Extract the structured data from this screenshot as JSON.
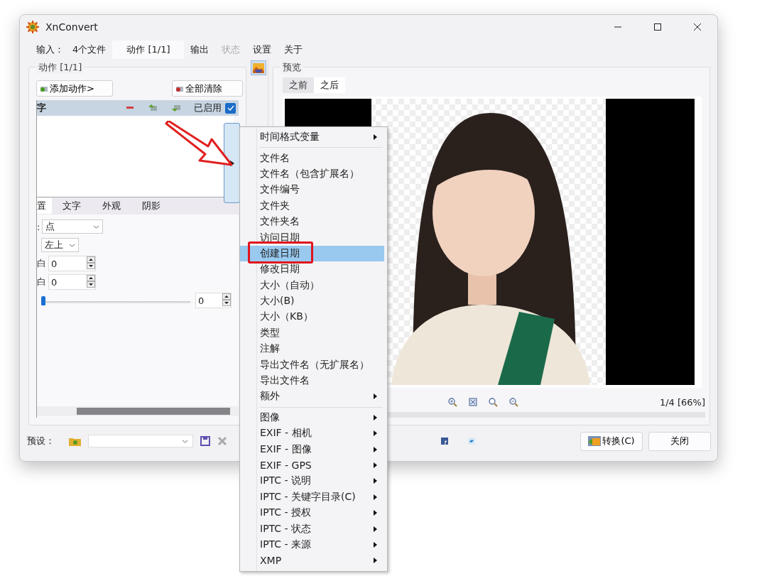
{
  "window": {
    "title": "XnConvert"
  },
  "tabs": [
    {
      "label": "输入：",
      "count": "4个文件",
      "selected": false,
      "disabled": false
    },
    {
      "label": "动作 [1/1]",
      "selected": true,
      "disabled": false
    },
    {
      "label": "输出",
      "selected": false,
      "disabled": false
    },
    {
      "label": "状态",
      "selected": false,
      "disabled": true
    },
    {
      "label": "设置",
      "selected": false,
      "disabled": false
    },
    {
      "label": "关于",
      "selected": false,
      "disabled": false
    }
  ],
  "actions_panel": {
    "title": "动作 [1/1]",
    "add_button": "添加动作>",
    "clear_button": "全部清除",
    "action": {
      "name": "字",
      "enabled_label": "已启用",
      "enabled": true
    },
    "subtabs": [
      {
        "label": "置",
        "selected": true
      },
      {
        "label": "文字",
        "selected": false
      },
      {
        "label": "外观",
        "selected": false
      },
      {
        "label": "阴影",
        "selected": false
      }
    ],
    "fields": [
      {
        "kind": "select",
        "label": ":",
        "value": "点"
      },
      {
        "kind": "select",
        "value": "左上"
      },
      {
        "kind": "spin",
        "label": "白",
        "value": "0"
      },
      {
        "kind": "spin",
        "label": "白",
        "value": "0"
      },
      {
        "kind": "slider",
        "level": 0,
        "value": "0"
      }
    ]
  },
  "preview": {
    "title": "预览",
    "tabs": [
      {
        "label": "之前",
        "selected": false
      },
      {
        "label": "之后",
        "selected": true
      }
    ],
    "page_info": "1/4 [66%]"
  },
  "footer": {
    "preset_label": "预设：",
    "convert_button": "转换(C)",
    "close_button": "关闭"
  },
  "context_menu": {
    "items": [
      {
        "kind": "item",
        "label": "时间格式变量",
        "submenu": true,
        "selected": false
      },
      {
        "kind": "separator"
      },
      {
        "kind": "item",
        "label": "文件名",
        "submenu": false,
        "selected": false
      },
      {
        "kind": "item",
        "label": "文件名（包含扩展名）",
        "submenu": false,
        "selected": false
      },
      {
        "kind": "item",
        "label": "文件编号",
        "submenu": false,
        "selected": false
      },
      {
        "kind": "item",
        "label": "文件夹",
        "submenu": false,
        "selected": false
      },
      {
        "kind": "item",
        "label": "文件夹名",
        "submenu": false,
        "selected": false
      },
      {
        "kind": "item",
        "label": "访问日期",
        "submenu": false,
        "selected": false
      },
      {
        "kind": "item",
        "label": "创建日期",
        "submenu": false,
        "selected": true
      },
      {
        "kind": "item",
        "label": "修改日期",
        "submenu": false,
        "selected": false
      },
      {
        "kind": "item",
        "label": "大小（自动）",
        "submenu": false,
        "selected": false
      },
      {
        "kind": "item",
        "label": "大小(B)",
        "submenu": false,
        "selected": false
      },
      {
        "kind": "item",
        "label": "大小（KB）",
        "submenu": false,
        "selected": false
      },
      {
        "kind": "item",
        "label": "类型",
        "submenu": false,
        "selected": false
      },
      {
        "kind": "item",
        "label": "注解",
        "submenu": false,
        "selected": false
      },
      {
        "kind": "item",
        "label": "导出文件名（无扩展名）",
        "submenu": false,
        "selected": false
      },
      {
        "kind": "item",
        "label": "导出文件名",
        "submenu": false,
        "selected": false
      },
      {
        "kind": "item",
        "label": "额外",
        "submenu": true,
        "selected": false
      },
      {
        "kind": "separator"
      },
      {
        "kind": "item",
        "label": "图像",
        "submenu": true,
        "selected": false
      },
      {
        "kind": "item",
        "label": "EXIF - 相机",
        "submenu": true,
        "selected": false
      },
      {
        "kind": "item",
        "label": "EXIF - 图像",
        "submenu": true,
        "selected": false
      },
      {
        "kind": "item",
        "label": "EXIF - GPS",
        "submenu": true,
        "selected": false
      },
      {
        "kind": "item",
        "label": "IPTC - 说明",
        "submenu": true,
        "selected": false
      },
      {
        "kind": "item",
        "label": "IPTC - 关键字目录(C)",
        "submenu": true,
        "selected": false
      },
      {
        "kind": "item",
        "label": "IPTC - 授权",
        "submenu": true,
        "selected": false
      },
      {
        "kind": "item",
        "label": "IPTC - 状态",
        "submenu": true,
        "selected": false
      },
      {
        "kind": "item",
        "label": "IPTC - 来源",
        "submenu": true,
        "selected": false
      },
      {
        "kind": "item",
        "label": "XMP",
        "submenu": true,
        "selected": false
      }
    ]
  }
}
